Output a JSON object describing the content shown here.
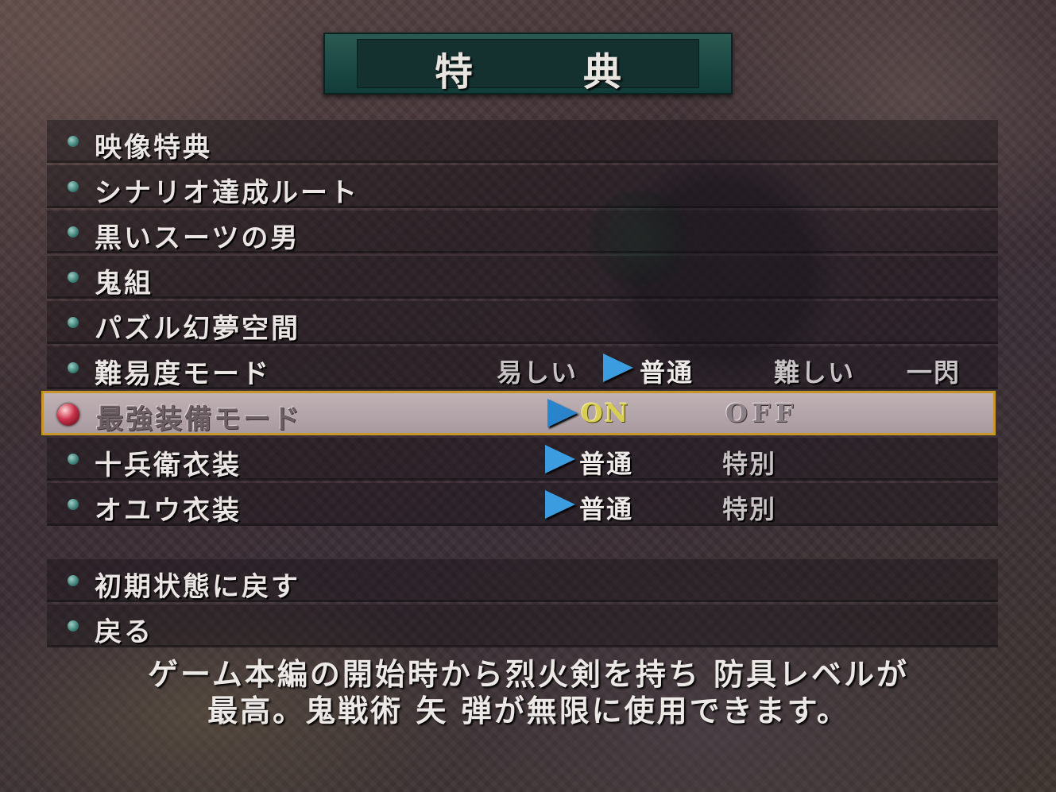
{
  "title": {
    "left": "特",
    "right": "典"
  },
  "menu": {
    "items": [
      {
        "label": "映像特典"
      },
      {
        "label": "シナリオ達成ルート"
      },
      {
        "label": "黒いスーツの男"
      },
      {
        "label": "鬼組"
      },
      {
        "label": "パズル幻夢空間"
      },
      {
        "label": "難易度モード",
        "options": [
          "易しい",
          "普通",
          "難しい",
          "一閃"
        ],
        "selected_option": "普通"
      },
      {
        "label": "最強装備モード",
        "options": [
          "ON",
          "OFF"
        ],
        "selected_option": "ON"
      },
      {
        "label": "十兵衛衣装",
        "options": [
          "普通",
          "特別"
        ],
        "selected_option": "普通"
      },
      {
        "label": "オユウ衣装",
        "options": [
          "普通",
          "特別"
        ],
        "selected_option": "普通"
      }
    ],
    "cursor_item": "最強装備モード"
  },
  "actions": [
    {
      "label": "初期状態に戻す"
    },
    {
      "label": "戻る"
    }
  ],
  "description": {
    "line1": "ゲーム本編の開始時から烈火剣を持ち 防具レベルが",
    "line2": "最高。鬼戦術 矢 弾が無限に使用できます。"
  },
  "colors": {
    "title_plate": "#1f4c47",
    "selection_border": "#c8952a",
    "selector_arrow": "#3b9de0",
    "on_text": "#d8cd55"
  },
  "icons": {
    "bullet": "teal-orb-icon",
    "cursor": "red-gem-icon",
    "selector": "blue-triangle-arrow-icon"
  }
}
